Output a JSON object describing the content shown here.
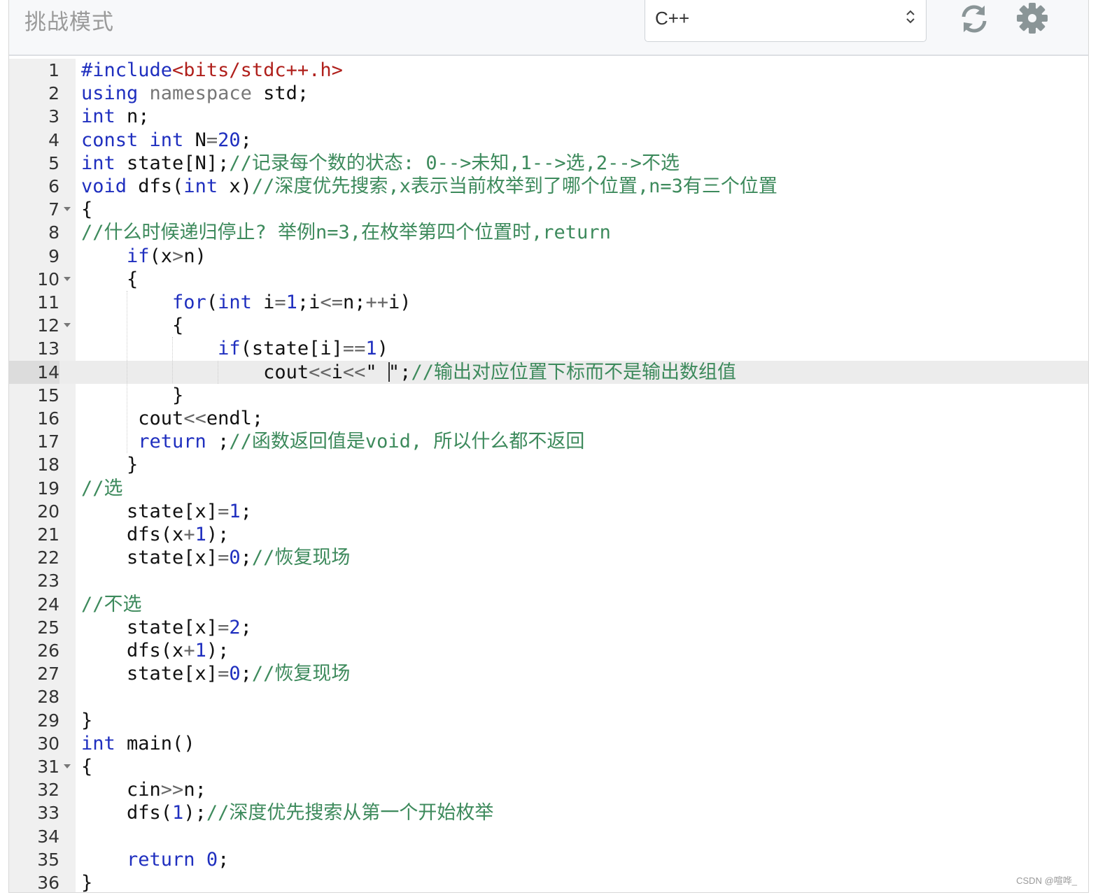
{
  "header": {
    "title": "挑战模式",
    "language_select": {
      "value": "C++"
    },
    "icons": [
      "refresh-icon",
      "gear-icon"
    ]
  },
  "editor": {
    "active_line": 14,
    "fold_lines": [
      7,
      10,
      12,
      31
    ],
    "colors": {
      "keyword": "#1f2fbf",
      "string": "#b0201c",
      "comment": "#3d8a5c",
      "number": "#1f2fbf",
      "operator": "#666666"
    },
    "lines": [
      [
        [
          "k",
          "#include"
        ],
        [
          "s",
          "<bits/stdc++.h>"
        ]
      ],
      [
        [
          "k",
          "using"
        ],
        [
          "t",
          " "
        ],
        [
          "v",
          "namespace"
        ],
        [
          "t",
          " std;"
        ]
      ],
      [
        [
          "k",
          "int"
        ],
        [
          "t",
          " n;"
        ]
      ],
      [
        [
          "k",
          "const"
        ],
        [
          "t",
          " "
        ],
        [
          "k",
          "int"
        ],
        [
          "t",
          " N"
        ],
        [
          "o",
          "="
        ],
        [
          "n",
          "20"
        ],
        [
          "t",
          ";"
        ]
      ],
      [
        [
          "k",
          "int"
        ],
        [
          "t",
          " state[N];"
        ],
        [
          "c",
          "//记录每个数的状态: 0-->未知,1-->选,2-->不选"
        ]
      ],
      [
        [
          "k",
          "void"
        ],
        [
          "t",
          " dfs("
        ],
        [
          "k",
          "int"
        ],
        [
          "t",
          " x)"
        ],
        [
          "c",
          "//深度优先搜索,x表示当前枚举到了哪个位置,n=3有三个位置"
        ]
      ],
      [
        [
          "t",
          "{"
        ]
      ],
      [
        [
          "c",
          "//什么时候递归停止? 举例n=3,在枚举第四个位置时,return"
        ]
      ],
      [
        [
          "t",
          "    "
        ],
        [
          "k",
          "if"
        ],
        [
          "t",
          "(x"
        ],
        [
          "o",
          ">"
        ],
        [
          "t",
          "n)"
        ]
      ],
      [
        [
          "t",
          "    {"
        ]
      ],
      [
        [
          "t",
          "        "
        ],
        [
          "k",
          "for"
        ],
        [
          "t",
          "("
        ],
        [
          "k",
          "int"
        ],
        [
          "t",
          " i"
        ],
        [
          "o",
          "="
        ],
        [
          "n",
          "1"
        ],
        [
          "t",
          ";i"
        ],
        [
          "o",
          "<="
        ],
        [
          "t",
          "n;"
        ],
        [
          "o",
          "++"
        ],
        [
          "t",
          "i)"
        ]
      ],
      [
        [
          "t",
          "        {"
        ]
      ],
      [
        [
          "t",
          "            "
        ],
        [
          "k",
          "if"
        ],
        [
          "t",
          "(state[i]"
        ],
        [
          "o",
          "=="
        ],
        [
          "n",
          "1"
        ],
        [
          "t",
          ")"
        ]
      ],
      [
        [
          "t",
          "                cout"
        ],
        [
          "o",
          "<<"
        ],
        [
          "t",
          "i"
        ],
        [
          "o",
          "<<"
        ],
        [
          "t",
          "\" "
        ],
        [
          "cursor",
          ""
        ],
        [
          "t",
          "\";"
        ],
        [
          "c",
          "//输出对应位置下标而不是输出数组值"
        ]
      ],
      [
        [
          "t",
          "        }"
        ]
      ],
      [
        [
          "t",
          "     cout"
        ],
        [
          "o",
          "<<"
        ],
        [
          "t",
          "endl;"
        ]
      ],
      [
        [
          "t",
          "     "
        ],
        [
          "k",
          "return"
        ],
        [
          "t",
          " ;"
        ],
        [
          "c",
          "//函数返回值是void, 所以什么都不返回"
        ]
      ],
      [
        [
          "t",
          "    }"
        ]
      ],
      [
        [
          "c",
          "//选"
        ]
      ],
      [
        [
          "t",
          "    state[x]"
        ],
        [
          "o",
          "="
        ],
        [
          "n",
          "1"
        ],
        [
          "t",
          ";"
        ]
      ],
      [
        [
          "t",
          "    dfs(x"
        ],
        [
          "o",
          "+"
        ],
        [
          "n",
          "1"
        ],
        [
          "t",
          ");"
        ]
      ],
      [
        [
          "t",
          "    state[x]"
        ],
        [
          "o",
          "="
        ],
        [
          "n",
          "0"
        ],
        [
          "t",
          ";"
        ],
        [
          "c",
          "//恢复现场"
        ]
      ],
      [],
      [
        [
          "c",
          "//不选"
        ]
      ],
      [
        [
          "t",
          "    state[x]"
        ],
        [
          "o",
          "="
        ],
        [
          "n",
          "2"
        ],
        [
          "t",
          ";"
        ]
      ],
      [
        [
          "t",
          "    dfs(x"
        ],
        [
          "o",
          "+"
        ],
        [
          "n",
          "1"
        ],
        [
          "t",
          ");"
        ]
      ],
      [
        [
          "t",
          "    state[x]"
        ],
        [
          "o",
          "="
        ],
        [
          "n",
          "0"
        ],
        [
          "t",
          ";"
        ],
        [
          "c",
          "//恢复现场"
        ]
      ],
      [],
      [
        [
          "t",
          "}"
        ]
      ],
      [
        [
          "k",
          "int"
        ],
        [
          "t",
          " main()"
        ]
      ],
      [
        [
          "t",
          "{"
        ]
      ],
      [
        [
          "t",
          "    cin"
        ],
        [
          "o",
          ">>"
        ],
        [
          "t",
          "n;"
        ]
      ],
      [
        [
          "t",
          "    dfs("
        ],
        [
          "n",
          "1"
        ],
        [
          "t",
          ");"
        ],
        [
          "c",
          "//深度优先搜索从第一个开始枚举"
        ]
      ],
      [],
      [
        [
          "t",
          "    "
        ],
        [
          "k",
          "return"
        ],
        [
          "t",
          " "
        ],
        [
          "n",
          "0"
        ],
        [
          "t",
          ";"
        ]
      ],
      [
        [
          "t",
          "}"
        ]
      ]
    ]
  },
  "watermark": "CSDN @喧哗_"
}
